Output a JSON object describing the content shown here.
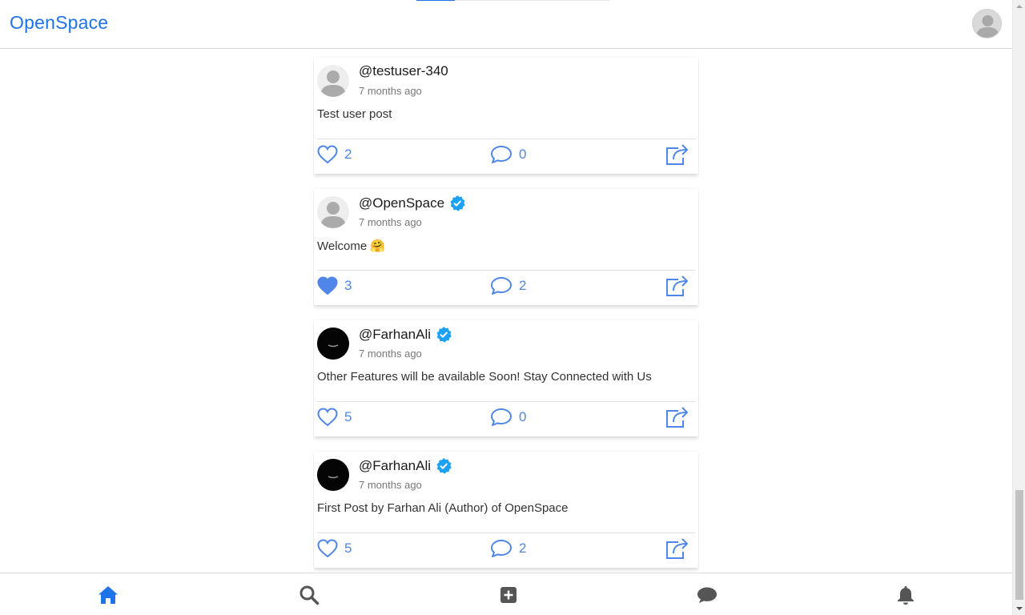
{
  "app": {
    "brand": "OpenSpace"
  },
  "header": {
    "scroll_progress": 0.2,
    "avatar_icon": "user-avatar-icon"
  },
  "colors": {
    "accent": "#1e73e8",
    "action": "#4f86e8",
    "verified": "#1da1f2",
    "nav_inactive": "#555555"
  },
  "posts": [
    {
      "username": "@testuser-340",
      "verified": false,
      "avatar": "default",
      "time": "7 months ago",
      "content": "Test user post",
      "likes": "2",
      "liked": false,
      "comments": "0"
    },
    {
      "username": "@OpenSpace",
      "verified": true,
      "avatar": "default",
      "time": "7 months ago",
      "content": "Welcome 🤗",
      "likes": "3",
      "liked": true,
      "comments": "2"
    },
    {
      "username": "@FarhanAli",
      "verified": true,
      "avatar": "dark",
      "time": "7 months ago",
      "content": "Other Features will be available Soon! Stay Connected with Us",
      "likes": "5",
      "liked": false,
      "comments": "0"
    },
    {
      "username": "@FarhanAli",
      "verified": true,
      "avatar": "dark",
      "time": "7 months ago",
      "content": "First Post by Farhan Ali (Author) of OpenSpace",
      "likes": "5",
      "liked": false,
      "comments": "2"
    }
  ],
  "bottom_nav": [
    {
      "icon": "home-icon",
      "active": true
    },
    {
      "icon": "search-icon",
      "active": false
    },
    {
      "icon": "add-post-icon",
      "active": false
    },
    {
      "icon": "chat-icon",
      "active": false
    },
    {
      "icon": "bell-icon",
      "active": false
    }
  ]
}
